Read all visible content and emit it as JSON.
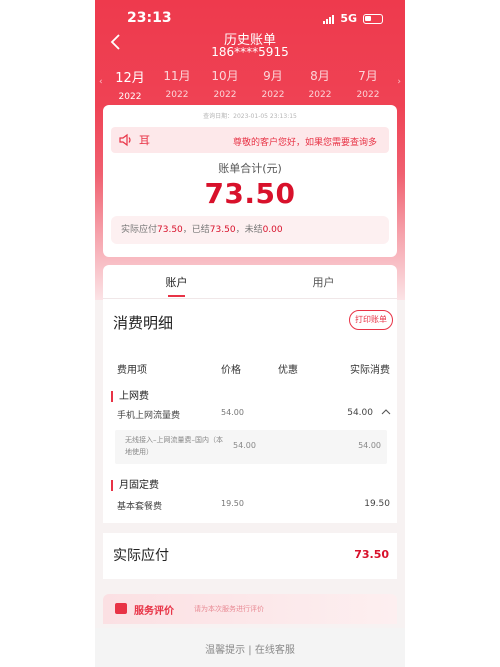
{
  "status_bar": {
    "time": "23:13",
    "network": "5G"
  },
  "header": {
    "title": "历史账单",
    "phone": "186****5915"
  },
  "months": [
    {
      "month": "12月",
      "year": "2022",
      "active": true
    },
    {
      "month": "11月",
      "year": "2022"
    },
    {
      "month": "10月",
      "year": "2022"
    },
    {
      "month": "9月",
      "year": "2022"
    },
    {
      "month": "8月",
      "year": "2022"
    },
    {
      "month": "7月",
      "year": "2022"
    }
  ],
  "bill": {
    "query_date": "查询日期：2023-01-05 23:13:15",
    "notice_ear": "耳",
    "notice_text": "尊敬的客户您好，如果您需要查询多",
    "total_label": "账单合计(元)",
    "total_amount": "73.50",
    "summary_prefix": "实际应付",
    "summary_due": "73.50",
    "summary_mid": "，已结",
    "summary_paid": "73.50",
    "summary_mid2": "，未结",
    "summary_unpaid": "0.00"
  },
  "main_tabs": {
    "account": "账户",
    "user": "用户"
  },
  "detail": {
    "title": "消费明细",
    "print_label": "打印账单",
    "headers": {
      "item": "费用项",
      "price": "价格",
      "discount": "优惠",
      "actual": "实际消费"
    },
    "internet": {
      "category": "上网费",
      "name": "手机上网流量费",
      "price": "54.00",
      "actual": "54.00",
      "sub_name": "无线接入–上网流量费–国内（本地使用）",
      "sub_price": "54.00",
      "sub_actual": "54.00"
    },
    "monthly": {
      "category": "月固定费",
      "name": "基本套餐费",
      "price": "19.50",
      "actual": "19.50"
    }
  },
  "pay": {
    "label": "实际应付",
    "amount": "73.50"
  },
  "evaluation": {
    "title": "服务评价",
    "desc": "请为本次服务进行评价"
  },
  "footer": {
    "tip": "温馨提示",
    "separator": " | ",
    "service": "在线客服"
  }
}
